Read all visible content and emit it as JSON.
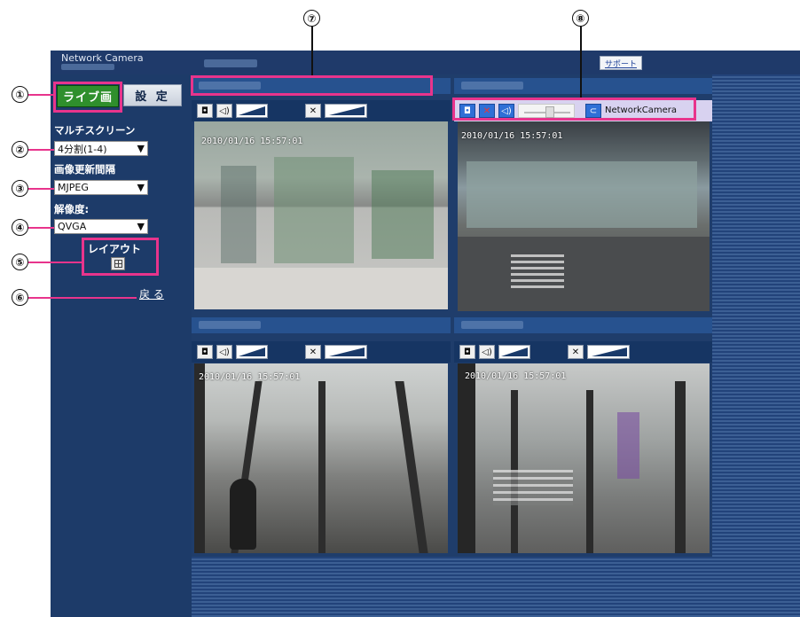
{
  "header": {
    "app_title": "Network Camera",
    "support_label": "サポート"
  },
  "sidebar": {
    "live_button": "ライブ画",
    "settings_button": "設 定",
    "multiscreen_label": "マルチスクリーン",
    "multiscreen_value": "4分割(1-4)",
    "refresh_label": "画像更新間隔",
    "refresh_value": "MJPEG",
    "resolution_label": "解像度:",
    "resolution_value": "QVGA",
    "layout_label": "レイアウト",
    "back_link": "戻 る"
  },
  "callouts": [
    "①",
    "②",
    "③",
    "④",
    "⑤",
    "⑥",
    "⑦",
    "⑧"
  ],
  "cameras": [
    {
      "timestamp": "2010/01/16 15:57:01"
    },
    {
      "timestamp": "2010/01/16 15:57:01",
      "toolbar_label": "NetworkCamera"
    },
    {
      "timestamp": "2010/01/16 15:57:01"
    },
    {
      "timestamp": "2010/01/16 15:57:01"
    }
  ],
  "colors": {
    "accent": "#e8348c",
    "panel": "#1d3b69",
    "live": "#2f8f2c"
  }
}
